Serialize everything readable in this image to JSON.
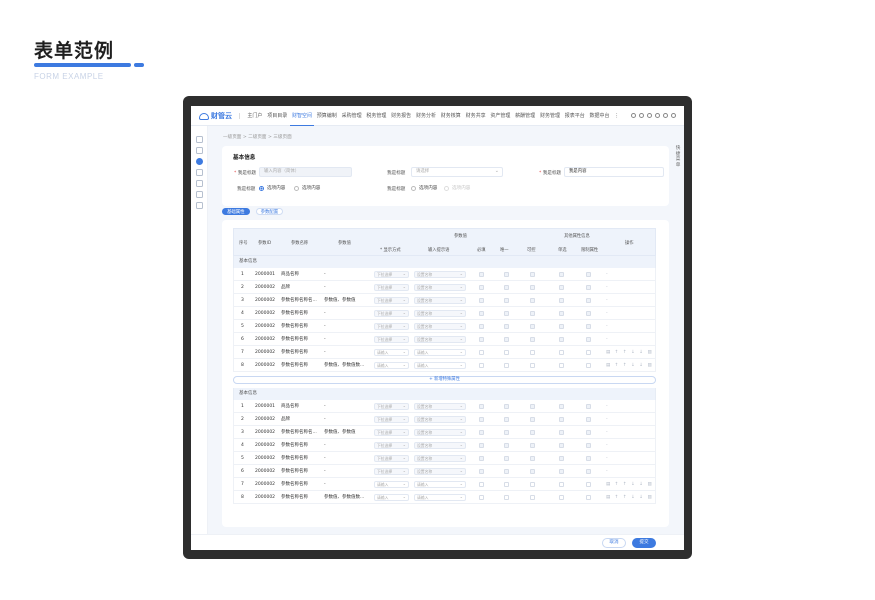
{
  "heading": {
    "title": "表单范例",
    "subtitle": "FORM EXAMPLE"
  },
  "nav": {
    "logo": "财管云",
    "items": [
      "主门户",
      "项目目录",
      "财智空间",
      "预算编制",
      "采购管理",
      "税务管理",
      "财务报告",
      "财务分析",
      "财务核算",
      "财务共享",
      "资产管理",
      "薪酬管理",
      "财务管理",
      "报表平台",
      "数据中台"
    ],
    "more": "⋮",
    "active_index": 2
  },
  "breadcrumb": "一级页面  >  二级页面  >  三级页面",
  "right_tab": "快捷菜单",
  "form": {
    "section_title": "基本信息",
    "label1": "我是标题",
    "input1_placeholder": "输入内容（简体）",
    "label2": "我是标题",
    "select2_placeholder": "请选择",
    "label3": "我是标题",
    "input3_value": "我是内容",
    "label4": "我是标题",
    "radio4_a": "选项内容",
    "radio4_b": "选项内容",
    "label5": "我是标题",
    "radio5_a": "选项内容",
    "radio5_b": "选项内容"
  },
  "tabs": [
    "基础属性",
    "参数配置"
  ],
  "table": {
    "headers": {
      "index": "序号",
      "code": "参数ID",
      "name": "参数名称",
      "value": "参数值",
      "group1": "参数值",
      "display": "* 显示方式",
      "input_hint": "输入提示语",
      "required": "必填",
      "unique": "唯一",
      "readonly": "可控",
      "group2": "其他属性信息",
      "multi": "单选",
      "attr": "限制属性",
      "ops": "操作"
    },
    "group_label": "基本信息",
    "add_label": "+ 新增特殊属性",
    "rows": [
      {
        "idx": "1",
        "code": "2000001",
        "name": "商品名称",
        "value": "-",
        "sel": "下拉选择",
        "hint": "设置名称",
        "editable": false
      },
      {
        "idx": "2",
        "code": "2000002",
        "name": "品牌",
        "value": "-",
        "sel": "下拉选择",
        "hint": "设置名称",
        "editable": false
      },
      {
        "idx": "3",
        "code": "2000002",
        "name": "参数名称名称名...",
        "value": "参数值、参数值",
        "sel": "下拉选择",
        "hint": "设置名称",
        "editable": false
      },
      {
        "idx": "4",
        "code": "2000002",
        "name": "参数名称名称",
        "value": "-",
        "sel": "下拉选择",
        "hint": "设置名称",
        "editable": false
      },
      {
        "idx": "5",
        "code": "2000002",
        "name": "参数名称名称",
        "value": "-",
        "sel": "下拉选择",
        "hint": "设置名称",
        "editable": false
      },
      {
        "idx": "6",
        "code": "2000002",
        "name": "参数名称名称",
        "value": "-",
        "sel": "下拉选择",
        "hint": "设置名称",
        "editable": false
      },
      {
        "idx": "7",
        "code": "2000002",
        "name": "参数名称名称",
        "value": "-",
        "sel": "请输入",
        "hint": "请输入",
        "editable": true
      },
      {
        "idx": "8",
        "code": "2000002",
        "name": "参数名称名称",
        "value": "参数值、参数值数...",
        "sel": "请输入",
        "hint": "请输入",
        "editable": true
      }
    ],
    "row_ops_static": "-",
    "row_ops_icons": "▤ ↑ ↑ ↓ ↓ ▥"
  },
  "footer": {
    "cancel": "取消",
    "ok": "提交"
  }
}
